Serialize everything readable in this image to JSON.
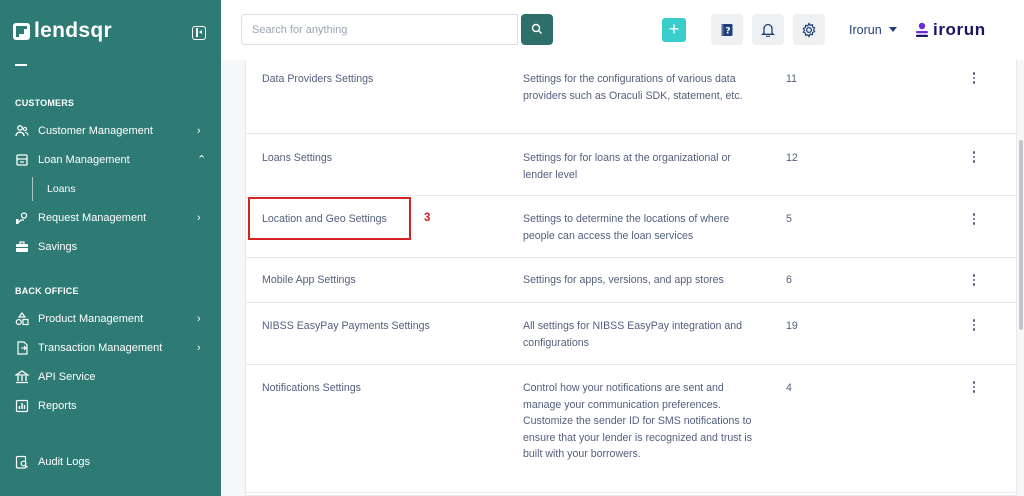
{
  "brand": {
    "name": "lendsqr"
  },
  "sidebar": {
    "sections": [
      {
        "title": "CUSTOMERS",
        "items": [
          {
            "label": "Customer Management",
            "icon": "users-icon",
            "chevron": "›"
          },
          {
            "label": "Loan Management",
            "icon": "bank-icon",
            "chevron": "⌃",
            "children": [
              {
                "label": "Loans"
              }
            ]
          },
          {
            "label": "Request Management",
            "icon": "request-icon",
            "chevron": "›"
          },
          {
            "label": "Savings",
            "icon": "briefcase-icon"
          }
        ]
      },
      {
        "title": "BACK OFFICE",
        "items": [
          {
            "label": "Product Management",
            "icon": "shapes-icon",
            "chevron": "›"
          },
          {
            "label": "Transaction Management",
            "icon": "transaction-icon",
            "chevron": "›"
          },
          {
            "label": "API Service",
            "icon": "building-icon"
          },
          {
            "label": "Reports",
            "icon": "chart-icon"
          },
          {
            "label": "Audit Logs",
            "icon": "clipboard-search-icon"
          }
        ]
      }
    ]
  },
  "topbar": {
    "search": {
      "placeholder": "Search for anything"
    },
    "user": {
      "name": "Irorun"
    },
    "tenant_logo": "irorun",
    "colors": {
      "accent": "#39cdcc",
      "primary": "#2e6f6a",
      "sidebar": "#2e7a74",
      "highlight": "#d42323"
    }
  },
  "settings_table": {
    "rows": [
      {
        "name": "Data Providers Settings",
        "description": "Settings for the configurations of various data providers such as Oraculi SDK, statement, etc.",
        "count": "11"
      },
      {
        "name": "Loans Settings",
        "description": "Settings for for loans at the organizational or lender level",
        "count": "12"
      },
      {
        "name": "Location and Geo Settings",
        "description": "Settings to determine the locations of where people can access the loan services",
        "count": "5"
      },
      {
        "name": "Mobile App Settings",
        "description": "Settings for apps, versions, and app stores",
        "count": "6"
      },
      {
        "name": "NIBSS EasyPay Payments Settings",
        "description": "All settings for NIBSS EasyPay integration and configurations",
        "count": "19"
      },
      {
        "name": "Notifications Settings",
        "description": "Control how your notifications are sent and manage your communication preferences. Customize the sender ID for SMS notifications to ensure that your lender is recognized and trust is built with your borrowers.",
        "count": "4"
      }
    ]
  },
  "annotation": {
    "label": "3"
  }
}
